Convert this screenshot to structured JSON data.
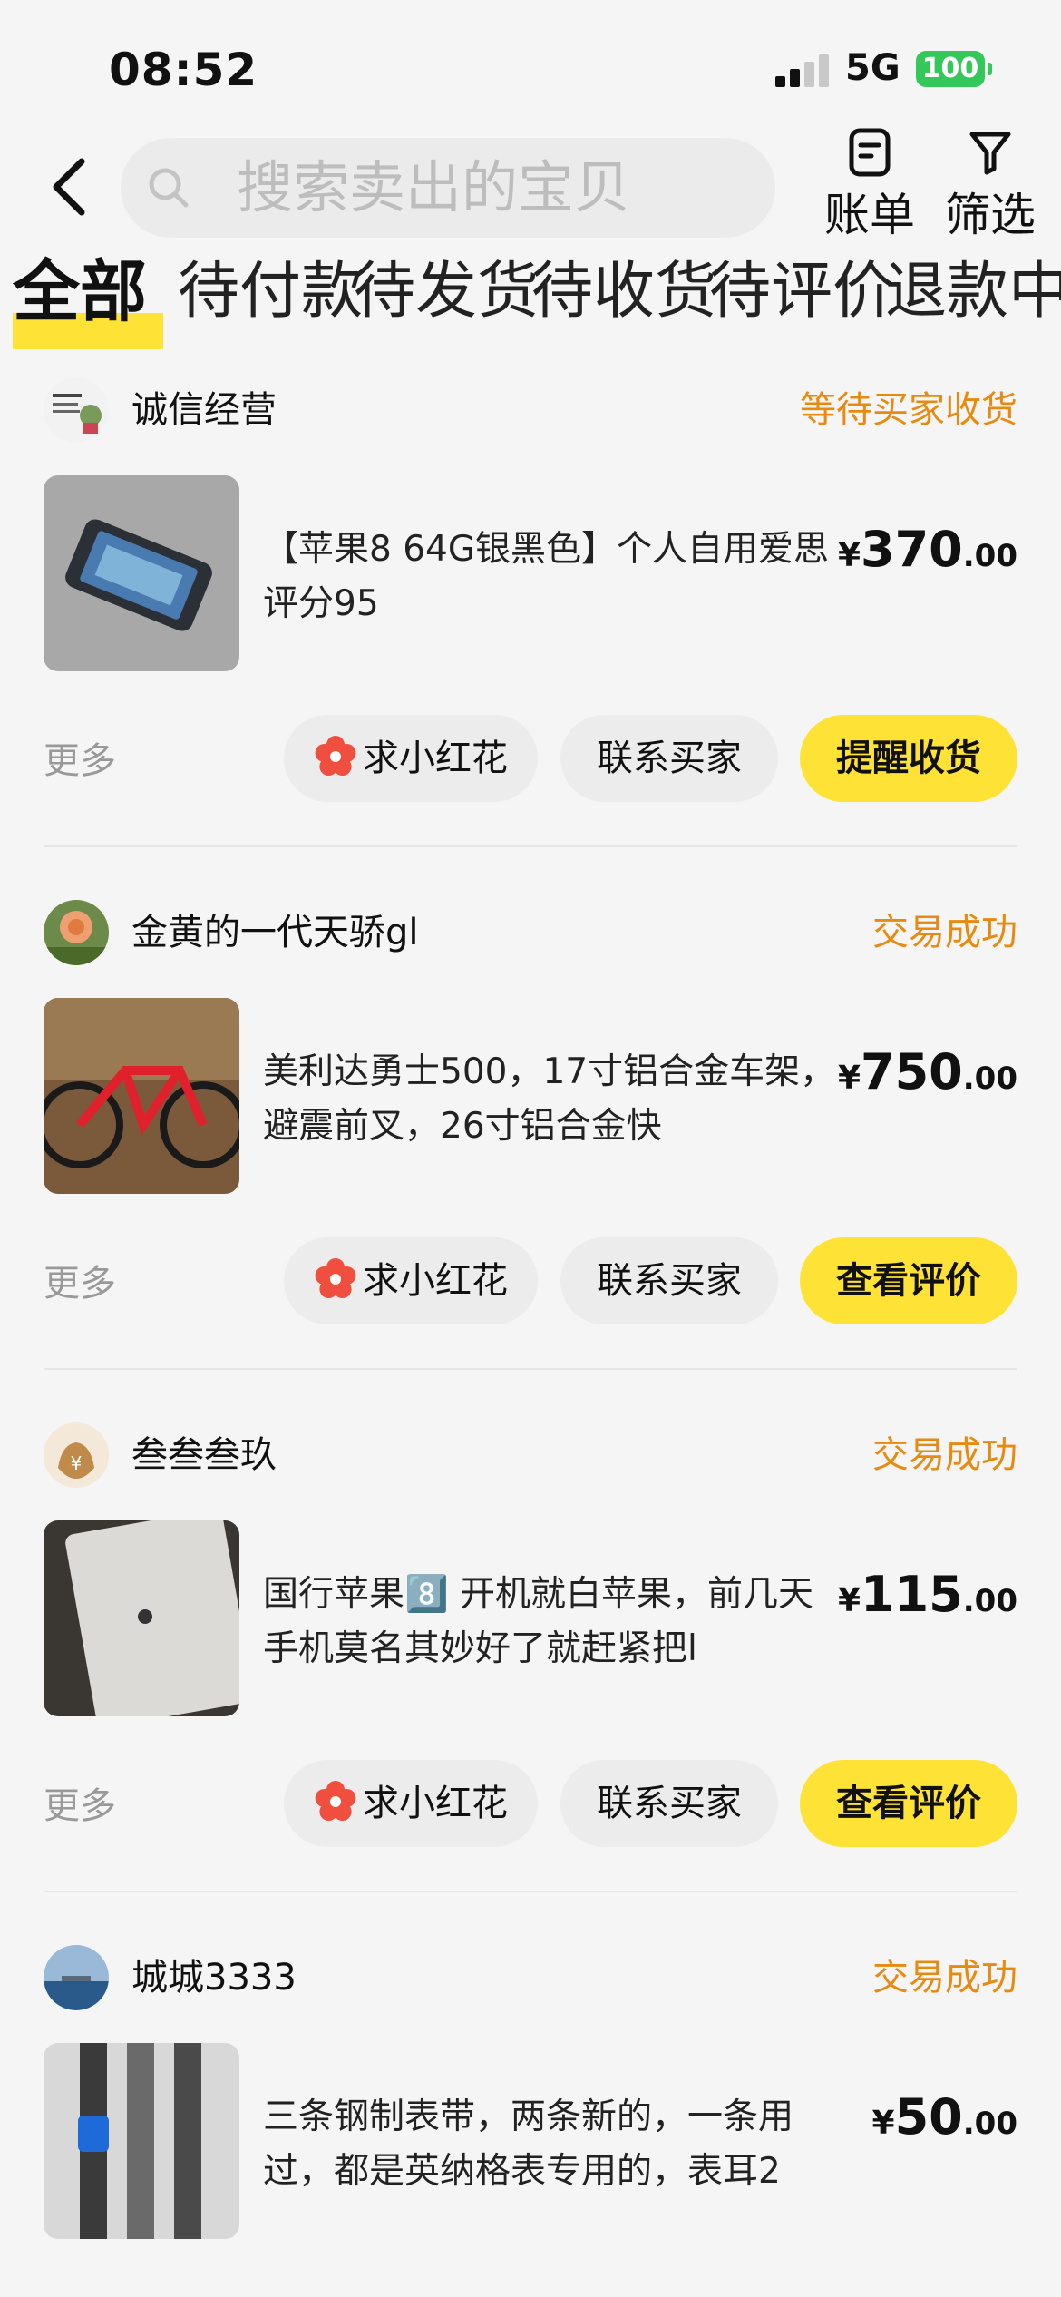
{
  "status_bar": {
    "time": "08:52",
    "network": "5G",
    "battery": "100"
  },
  "header": {
    "search_placeholder": "搜索卖出的宝贝",
    "bill_label": "账单",
    "filter_label": "筛选"
  },
  "tabs": [
    "全部",
    "待付款",
    "待发货",
    "待收货",
    "待评价",
    "退款中"
  ],
  "orders": [
    {
      "seller": "诚信经营",
      "status": "等待买家收货",
      "title": "【苹果8 64G银黑色】个人自用爱思评分95",
      "price_currency": "¥",
      "price_int": "370",
      "price_dec": ".00",
      "more": "更多",
      "flower_btn": "求小红花",
      "contact_btn": "联系买家",
      "primary_btn": "提醒收货"
    },
    {
      "seller": "金黄的一代天骄gl",
      "status": "交易成功",
      "title": "美利达勇士500，17寸铝合金车架，避震前叉，26寸铝合金快",
      "price_currency": "¥",
      "price_int": "750",
      "price_dec": ".00",
      "more": "更多",
      "flower_btn": "求小红花",
      "contact_btn": "联系买家",
      "primary_btn": "查看评价"
    },
    {
      "seller": "叁叁叁玖",
      "status": "交易成功",
      "title": "国行苹果8️⃣ 开机就白苹果，前几天手机莫名其妙好了就赶紧把l",
      "price_currency": "¥",
      "price_int": "115",
      "price_dec": ".00",
      "more": "更多",
      "flower_btn": "求小红花",
      "contact_btn": "联系买家",
      "primary_btn": "查看评价"
    },
    {
      "seller": "城城3333",
      "status": "交易成功",
      "title": "三条钢制表带，两条新的，一条用过，都是英纳格表专用的，表耳2",
      "price_currency": "¥",
      "price_int": "50",
      "price_dec": ".00"
    }
  ],
  "colors": {
    "accent": "#ffe236",
    "status": "#e88a10",
    "battery": "#34c759"
  }
}
